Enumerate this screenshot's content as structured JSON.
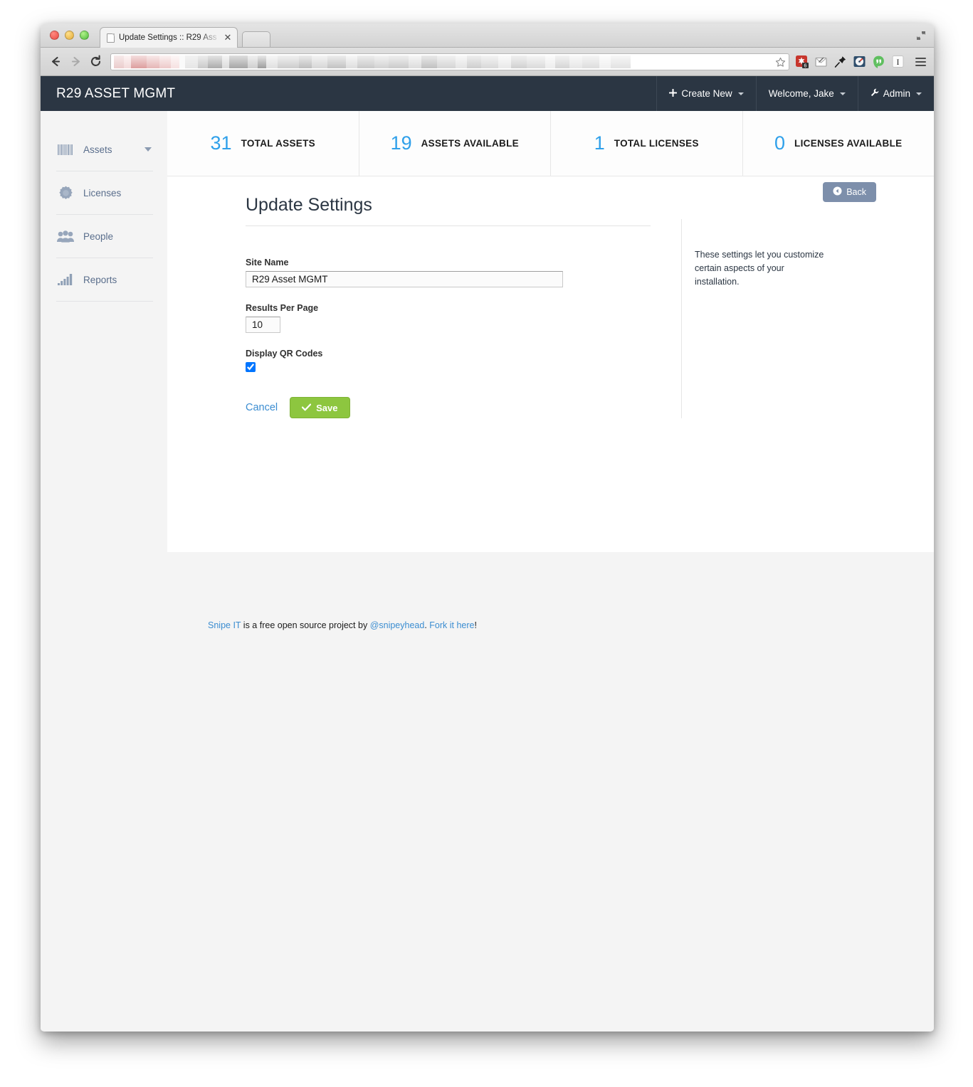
{
  "browser": {
    "tab_title": "Update Settings :: R29 Ass",
    "tab_close_glyph": "✕",
    "back_glyph": "←",
    "forward_glyph": "→",
    "reload_glyph": "↻",
    "star_glyph": "☆",
    "extension_badge_count": "6",
    "extension_letter": "I",
    "url_redacted": true
  },
  "app": {
    "brand": "R29 ASSET MGMT",
    "nav": [
      {
        "label": "Create New",
        "icon": "plus-icon",
        "has_caret": true
      },
      {
        "label": "Welcome, Jake",
        "icon": "",
        "has_caret": true
      },
      {
        "label": "Admin",
        "icon": "wrench-icon",
        "has_caret": true
      }
    ]
  },
  "stats": [
    {
      "value": "31",
      "label": "TOTAL ASSETS"
    },
    {
      "value": "19",
      "label": "ASSETS AVAILABLE"
    },
    {
      "value": "1",
      "label": "TOTAL LICENSES"
    },
    {
      "value": "0",
      "label": "LICENSES AVAILABLE"
    }
  ],
  "sidebar": {
    "items": [
      {
        "label": "Assets",
        "icon": "barcode-icon",
        "has_caret": true
      },
      {
        "label": "Licenses",
        "icon": "certificate-icon",
        "has_caret": false
      },
      {
        "label": "People",
        "icon": "people-group-icon",
        "has_caret": false
      },
      {
        "label": "Reports",
        "icon": "bar-chart-icon",
        "has_caret": false
      }
    ]
  },
  "main": {
    "title": "Update Settings",
    "back_label": "Back",
    "fields": {
      "site_name": {
        "label": "Site Name",
        "value": "R29 Asset MGMT",
        "placeholder": ""
      },
      "results_per_page": {
        "label": "Results Per Page",
        "value": "10",
        "placeholder": ""
      },
      "display_qr_codes": {
        "label": "Display QR Codes",
        "checked": true
      }
    },
    "cancel_label": "Cancel",
    "save_label": "Save",
    "help_text": "These settings let you customize certain aspects of your installation."
  },
  "footer": {
    "link1": "Snipe IT",
    "text1": " is a free open source project by ",
    "link2": "@snipeyhead",
    "text2": ". ",
    "link3": "Fork it here",
    "text3": "!"
  },
  "colors": {
    "navbar_bg": "#2b3643",
    "accent_blue": "#2fa0ea",
    "link_blue": "#3b8dd1",
    "save_green": "#8dc63f",
    "back_slate": "#7d8fab"
  }
}
